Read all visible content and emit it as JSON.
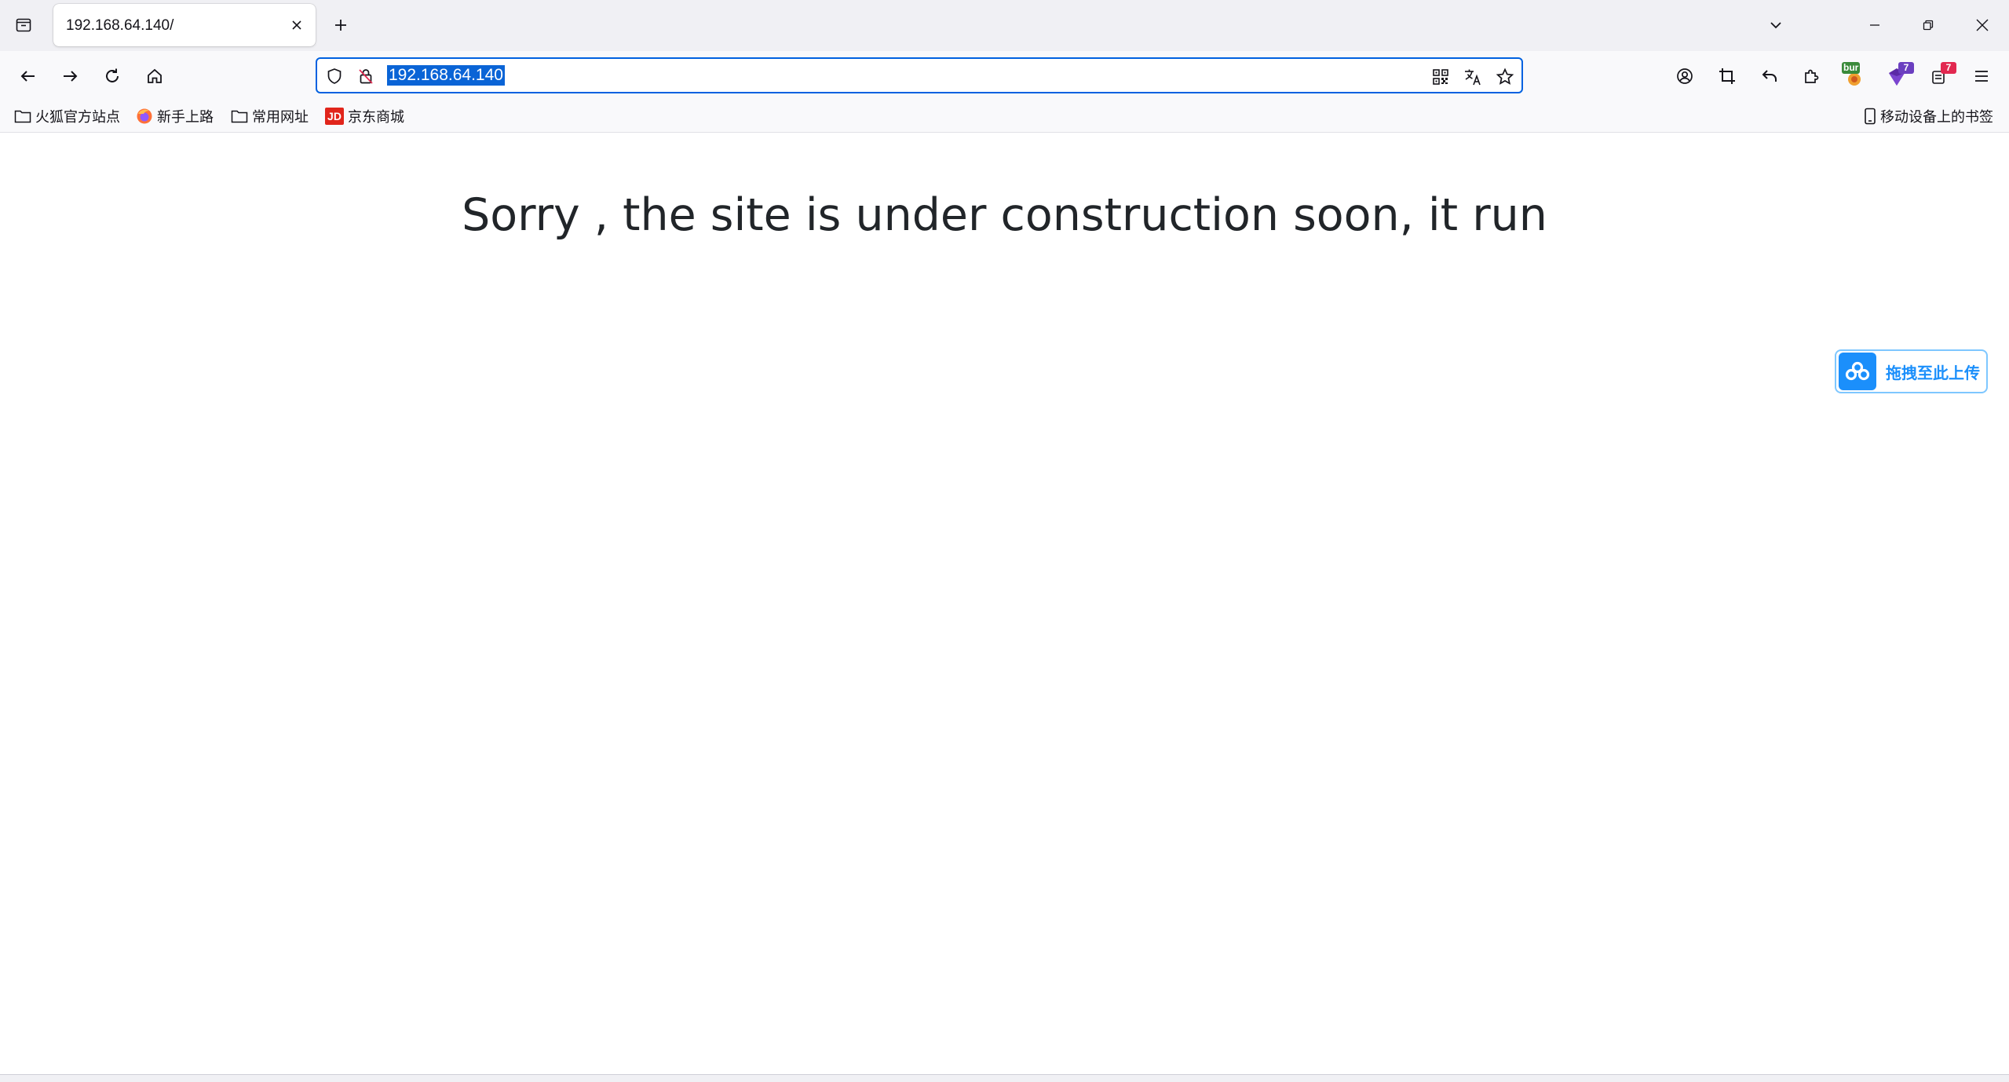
{
  "tab": {
    "title": "192.168.64.140/"
  },
  "nav": {
    "url": "192.168.64.140"
  },
  "bookmarks": [
    {
      "label": "火狐官方站点",
      "icon": "folder-icon"
    },
    {
      "label": "新手上路",
      "icon": "firefox-icon"
    },
    {
      "label": "常用网址",
      "icon": "folder-icon"
    },
    {
      "label": "京东商城",
      "icon": "jd-icon"
    }
  ],
  "bookmarks_right": {
    "label": "移动设备上的书签",
    "icon": "mobile-icon"
  },
  "extensions": {
    "burp_label": "bur",
    "ext2_badge": "7",
    "ext3_badge": "7"
  },
  "jd_logo_text": "JD",
  "page": {
    "headline": "Sorry , the site is under construction soon, it run"
  },
  "upload_widget": {
    "label": "拖拽至此上传"
  },
  "colors": {
    "accent": "#0061e0",
    "selection": "#0a64d6",
    "upload_blue": "#1b8ffb",
    "jd_red": "#e1251b"
  }
}
